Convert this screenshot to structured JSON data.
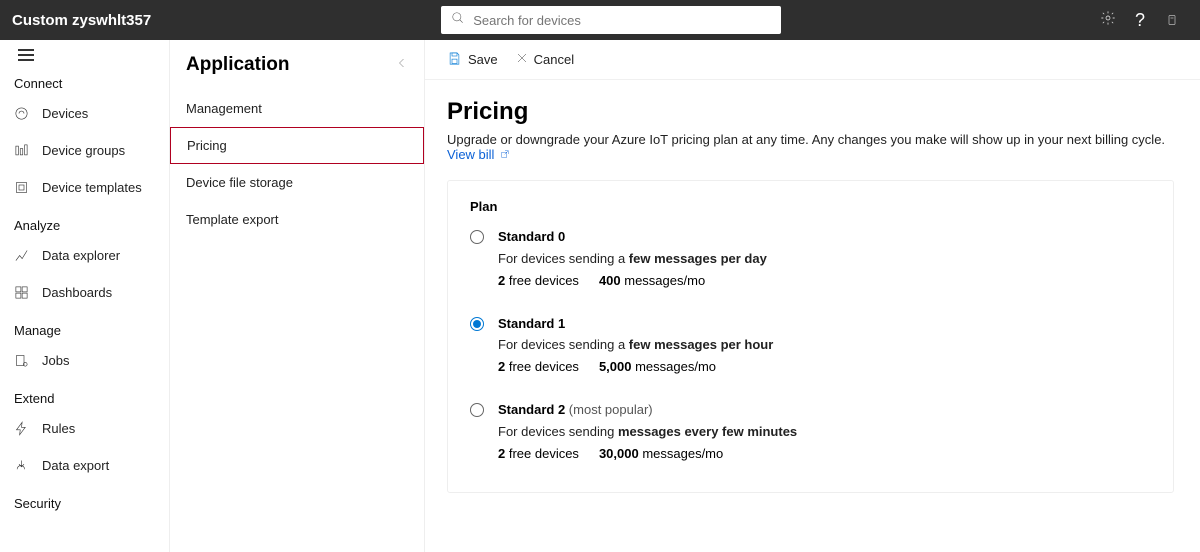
{
  "topbar": {
    "title": "Custom zyswhlt357",
    "search_placeholder": "Search for devices"
  },
  "left_nav": {
    "sections": [
      {
        "label": "Connect",
        "items": [
          {
            "icon": "device-icon",
            "label": "Devices"
          },
          {
            "icon": "groups-icon",
            "label": "Device groups"
          },
          {
            "icon": "template-icon",
            "label": "Device templates"
          }
        ]
      },
      {
        "label": "Analyze",
        "items": [
          {
            "icon": "explorer-icon",
            "label": "Data explorer"
          },
          {
            "icon": "dashboard-icon",
            "label": "Dashboards"
          }
        ]
      },
      {
        "label": "Manage",
        "items": [
          {
            "icon": "jobs-icon",
            "label": "Jobs"
          }
        ]
      },
      {
        "label": "Extend",
        "items": [
          {
            "icon": "rules-icon",
            "label": "Rules"
          },
          {
            "icon": "export-icon",
            "label": "Data export"
          }
        ]
      },
      {
        "label": "Security",
        "items": []
      }
    ]
  },
  "mid": {
    "title": "Application",
    "items": [
      {
        "label": "Management",
        "selected": false
      },
      {
        "label": "Pricing",
        "selected": true
      },
      {
        "label": "Device file storage",
        "selected": false
      },
      {
        "label": "Template export",
        "selected": false
      }
    ]
  },
  "actions": {
    "save_label": "Save",
    "cancel_label": "Cancel"
  },
  "page": {
    "title": "Pricing",
    "desc_pre": "Upgrade or downgrade your Azure IoT pricing plan at any time. Any changes you make will show up in your next billing cycle. ",
    "view_bill_label": "View bill"
  },
  "plans": {
    "header": "Plan",
    "list": [
      {
        "name": "Standard 0",
        "tag": "",
        "desc_pre": "For devices sending a ",
        "desc_bold": "few messages per day",
        "free_bold": "2",
        "free_label": " free devices",
        "msg_bold": "400",
        "msg_label": " messages/mo",
        "checked": false
      },
      {
        "name": "Standard 1",
        "tag": "",
        "desc_pre": "For devices sending a ",
        "desc_bold": "few messages per hour",
        "free_bold": "2",
        "free_label": " free devices",
        "msg_bold": "5,000",
        "msg_label": " messages/mo",
        "checked": true
      },
      {
        "name": "Standard 2",
        "tag": " (most popular)",
        "desc_pre": "For devices sending ",
        "desc_bold": "messages every few minutes",
        "free_bold": "2",
        "free_label": " free devices",
        "msg_bold": "30,000",
        "msg_label": " messages/mo",
        "checked": false
      }
    ]
  }
}
